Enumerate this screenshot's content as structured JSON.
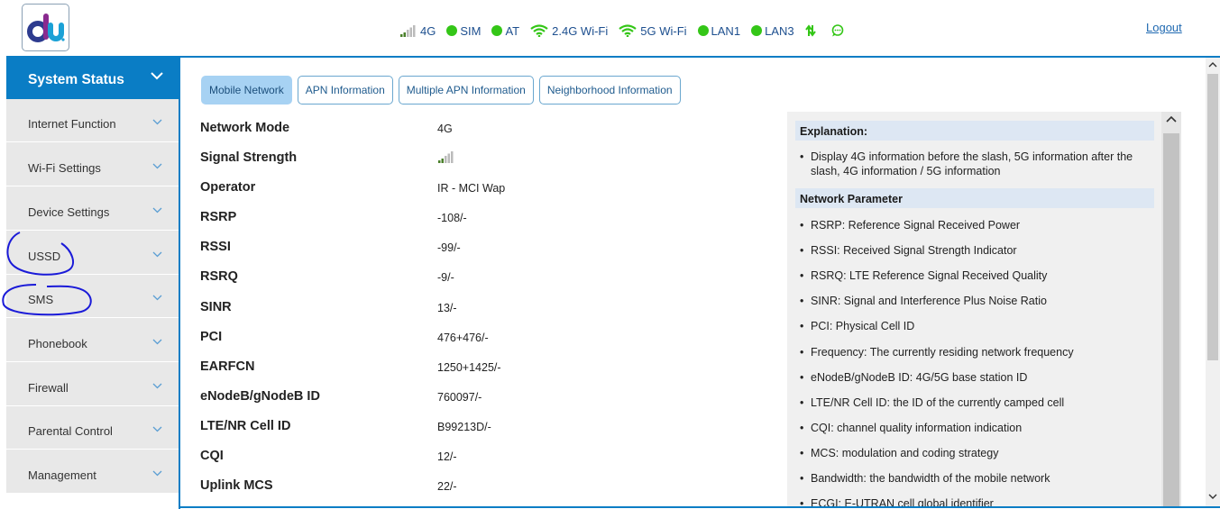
{
  "header": {
    "logo_text": "du",
    "status": [
      {
        "icon": "signal-icon",
        "label": "4G"
      },
      {
        "icon": "green-dot-icon",
        "label": "SIM"
      },
      {
        "icon": "green-dot-icon",
        "label": "AT"
      },
      {
        "icon": "wifi-icon",
        "label": "2.4G Wi-Fi"
      },
      {
        "icon": "wifi-icon",
        "label": "5G Wi-Fi"
      },
      {
        "icon": "green-dot-icon",
        "label": "LAN1"
      },
      {
        "icon": "green-dot-icon",
        "label": "LAN3"
      },
      {
        "icon": "data-transfer-icon",
        "label": ""
      },
      {
        "icon": "message-icon",
        "label": ""
      }
    ],
    "logout": "Logout"
  },
  "sidebar": {
    "title": "System Status",
    "items": [
      {
        "label": "Internet Function"
      },
      {
        "label": "Wi-Fi Settings"
      },
      {
        "label": "Device Settings"
      },
      {
        "label": "USSD"
      },
      {
        "label": "SMS"
      },
      {
        "label": "Phonebook"
      },
      {
        "label": "Firewall"
      },
      {
        "label": "Parental Control"
      },
      {
        "label": "Management"
      }
    ]
  },
  "tabs": [
    {
      "label": "Mobile Network",
      "active": true
    },
    {
      "label": "APN Information",
      "active": false
    },
    {
      "label": "Multiple APN Information",
      "active": false
    },
    {
      "label": "Neighborhood Information",
      "active": false
    }
  ],
  "network": [
    {
      "key": "Network Mode",
      "value": "4G"
    },
    {
      "key": "Signal Strength",
      "value": ""
    },
    {
      "key": "Operator",
      "value": "IR - MCI Wap"
    },
    {
      "key": "RSRP",
      "value": "-108/-"
    },
    {
      "key": "RSSI",
      "value": "-99/-"
    },
    {
      "key": "RSRQ",
      "value": "-9/-"
    },
    {
      "key": "SINR",
      "value": "13/-"
    },
    {
      "key": "PCI",
      "value": "476+476/-"
    },
    {
      "key": "EARFCN",
      "value": "1250+1425/-"
    },
    {
      "key": "eNodeB/gNodeB ID",
      "value": "760097/-"
    },
    {
      "key": "LTE/NR Cell ID",
      "value": "B99213D/-"
    },
    {
      "key": "CQI",
      "value": "12/-"
    },
    {
      "key": "Uplink MCS",
      "value": "22/-"
    }
  ],
  "explanation": {
    "heading": "Explanation:",
    "intro": "Display 4G information before the slash, 5G information after the slash, 4G information / 5G information",
    "param_heading": "Network Parameter",
    "params": [
      "RSRP: Reference Signal Received Power",
      "RSSI: Received Signal Strength Indicator",
      "RSRQ: LTE Reference Signal Received Quality",
      "SINR: Signal and Interference Plus Noise Ratio",
      "PCI: Physical Cell ID",
      "Frequency: The currently residing network frequency",
      "eNodeB/gNodeB ID: 4G/5G base station ID",
      "LTE/NR Cell ID: the ID of the currently camped cell",
      "CQI: channel quality information indication",
      "MCS: modulation and coding strategy",
      "Bandwidth: the bandwidth of the mobile network",
      "ECGI: E-UTRAN cell global identifier"
    ]
  },
  "colors": {
    "accent": "#0a7dc5",
    "status_green": "#34c617",
    "tab_active": "#a7d2f3",
    "annotation": "#1a1ad8"
  }
}
